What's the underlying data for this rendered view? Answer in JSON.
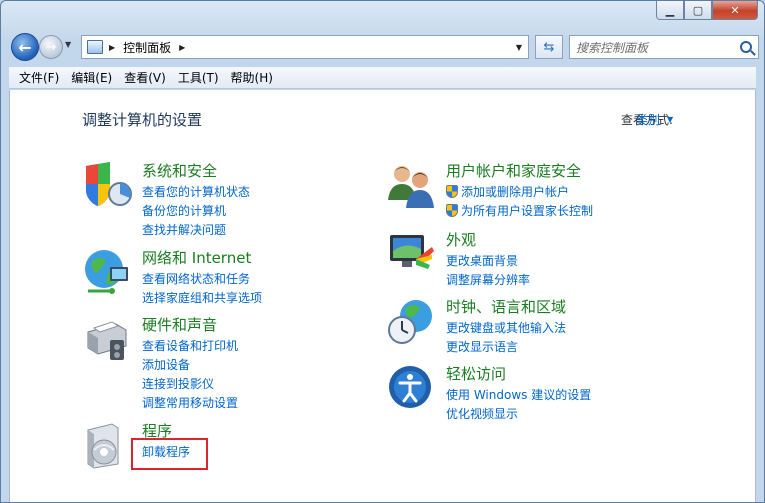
{
  "address": {
    "path": "控制面板"
  },
  "search": {
    "placeholder": "搜索控制面板"
  },
  "menu": [
    "文件(F)",
    "编辑(E)",
    "查看(V)",
    "工具(T)",
    "帮助(H)"
  ],
  "page": {
    "title": "调整计算机的设置",
    "view_by_label": "查看方式:",
    "view_by_value": "类别"
  },
  "categories": [
    {
      "title": "系统和安全",
      "icon": "shield-chart-icon",
      "links": [
        "查看您的计算机状态",
        "备份您的计算机",
        "查找并解决问题"
      ]
    },
    {
      "title": "网络和 Internet",
      "icon": "globe-network-icon",
      "links": [
        "查看网络状态和任务",
        "选择家庭组和共享选项"
      ]
    },
    {
      "title": "硬件和声音",
      "icon": "printer-icon",
      "links": [
        "查看设备和打印机",
        "添加设备",
        "连接到投影仪",
        "调整常用移动设置"
      ]
    },
    {
      "title": "程序",
      "icon": "programs-disc-icon",
      "links": [
        "卸载程序"
      ]
    },
    {
      "title": "用户帐户和家庭安全",
      "icon": "users-icon",
      "links": [
        "添加或删除用户帐户",
        "为所有用户设置家长控制"
      ]
    },
    {
      "title": "外观",
      "icon": "monitor-paint-icon",
      "links": [
        "更改桌面背景",
        "调整屏幕分辨率"
      ]
    },
    {
      "title": "时钟、语言和区域",
      "icon": "clock-globe-icon",
      "links": [
        "更改键盘或其他输入法",
        "更改显示语言"
      ]
    },
    {
      "title": "轻松访问",
      "icon": "ease-of-access-icon",
      "links": [
        "使用 Windows 建议的设置",
        "优化视频显示"
      ]
    }
  ]
}
